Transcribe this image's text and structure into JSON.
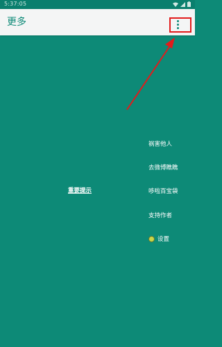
{
  "status_bar": {
    "time": "5:37:05"
  },
  "appbar": {
    "title": "更多",
    "menu_icon": "more-vert-icon"
  },
  "main": {
    "important_notice": "重要提示",
    "menu_items": [
      {
        "label": "祸害他人"
      },
      {
        "label": "去微博瞧瞧"
      },
      {
        "label": "哆啦百宝袋"
      },
      {
        "label": "支持作者"
      },
      {
        "label": "设置",
        "icon": "settings-icon"
      }
    ]
  },
  "colors": {
    "primary": "#0d8a77",
    "appbar": "#f4f5f5",
    "annotation": "#e21b1b"
  }
}
